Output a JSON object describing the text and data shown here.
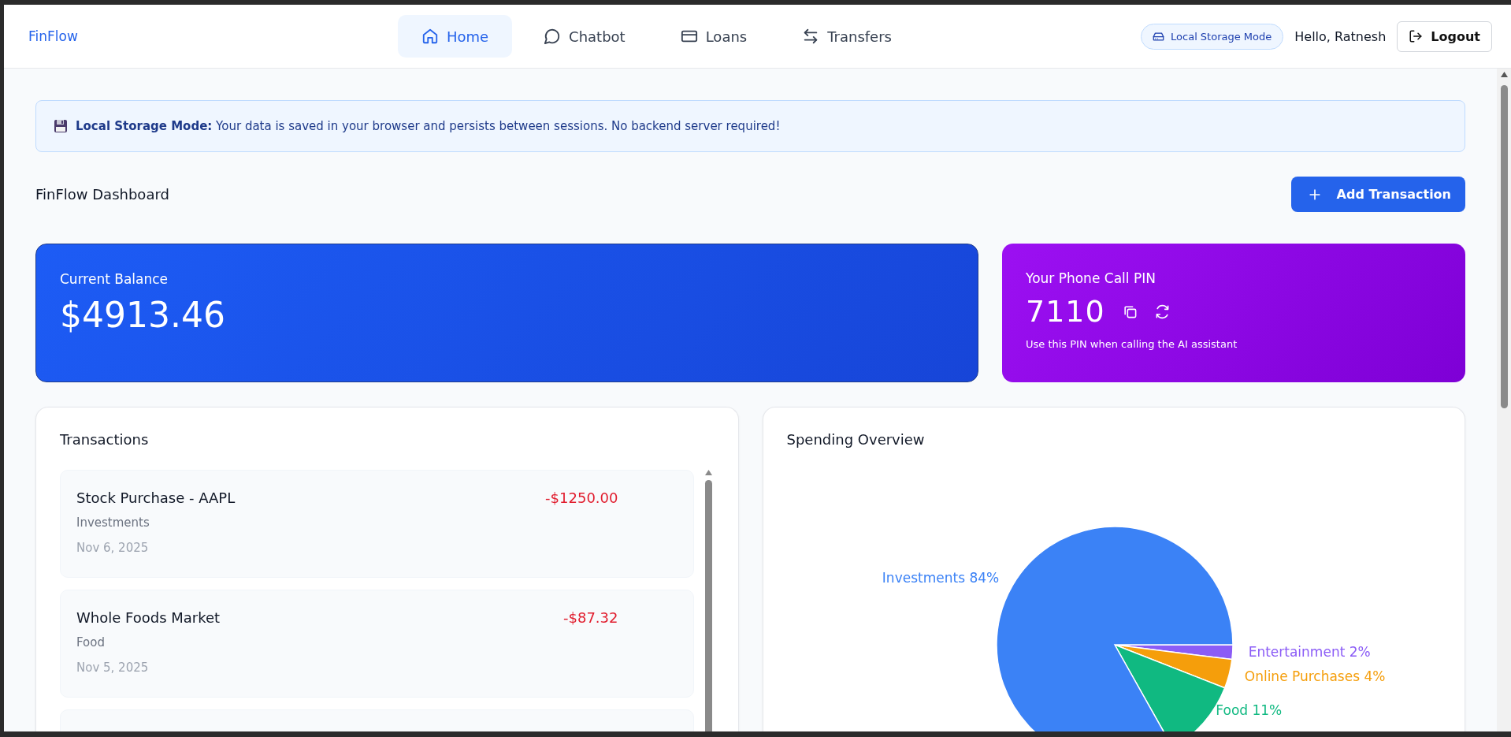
{
  "header": {
    "brand": "FinFlow",
    "nav": [
      {
        "label": "Home",
        "kind": "home",
        "selected": true
      },
      {
        "label": "Chatbot",
        "kind": "chat",
        "selected": false
      },
      {
        "label": "Loans",
        "kind": "loans",
        "selected": false
      },
      {
        "label": "Transfers",
        "kind": "transfers",
        "selected": false
      }
    ],
    "mode_badge": "Local Storage Mode",
    "greeting": "Hello, Ratnesh",
    "logout": "Logout"
  },
  "banner": {
    "text": "**Local Storage Mode:** Your data is saved in your browser and persists between sessions. No backend server required!"
  },
  "dashboard": {
    "title": "FinFlow Dashboard",
    "add_button": "Add Transaction"
  },
  "balance": {
    "label": "Current Balance",
    "amount": "$4913.46"
  },
  "pin": {
    "label": "Your Phone Call PIN",
    "pin": "7110",
    "hint": "Use this PIN when calling the AI assistant"
  },
  "transactions": {
    "title": "Transactions",
    "items": [
      {
        "name": "Stock Purchase - AAPL",
        "category": "Investments",
        "date": "Nov 6, 2025",
        "amount": "-$1250.00",
        "kind": "expense"
      },
      {
        "name": "Whole Foods Market",
        "category": "Food",
        "date": "Nov 5, 2025",
        "amount": "-$87.32",
        "kind": "expense"
      }
    ]
  },
  "spending": {
    "title": "Spending Overview",
    "chart_data": {
      "type": "pie",
      "categories": [
        "Entertainment",
        "Online Purchases",
        "Food",
        "Investments"
      ],
      "values": [
        2,
        4,
        11,
        84
      ],
      "colors": [
        "#8b5cf6",
        "#f59e0b",
        "#10b981",
        "#3b82f6"
      ],
      "value_labels": [
        "2%",
        "4%",
        "11%",
        "84%"
      ]
    }
  }
}
